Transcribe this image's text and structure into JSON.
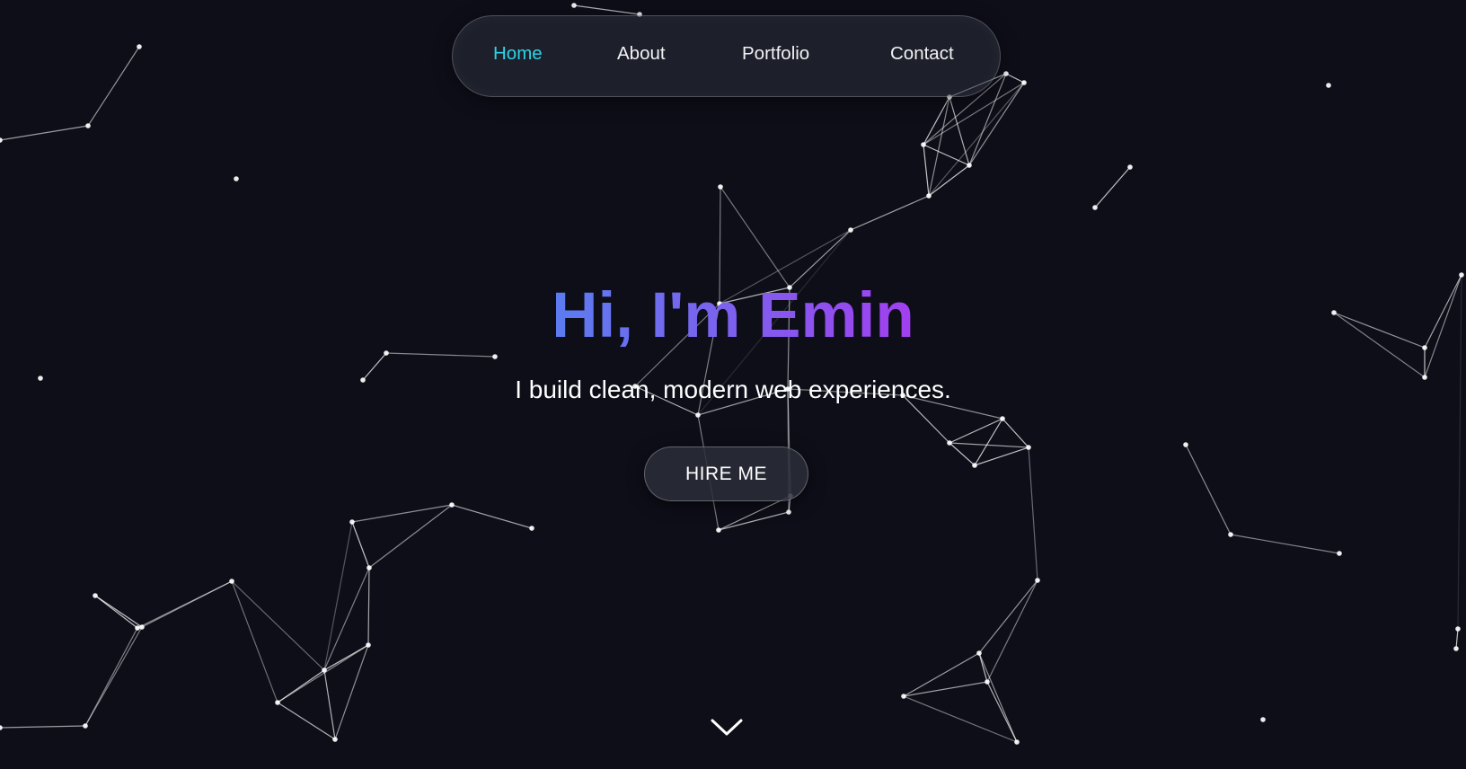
{
  "nav": {
    "items": [
      {
        "label": "Home",
        "active": true
      },
      {
        "label": "About",
        "active": false
      },
      {
        "label": "Portfolio",
        "active": false
      },
      {
        "label": "Contact",
        "active": false
      }
    ],
    "active_color": "#2ed3e6"
  },
  "hero": {
    "title": "Hi, I'm Emin",
    "subtitle": "I build clean, modern web experiences.",
    "cta_label": "HIRE ME",
    "title_gradient": [
      "#5b7cf0",
      "#a23ff0"
    ]
  },
  "scroll_indicator": {
    "icon": "chevron-down-icon"
  },
  "colors": {
    "background": "#0d0e18",
    "text": "#ffffff",
    "accent": "#2ed3e6"
  }
}
